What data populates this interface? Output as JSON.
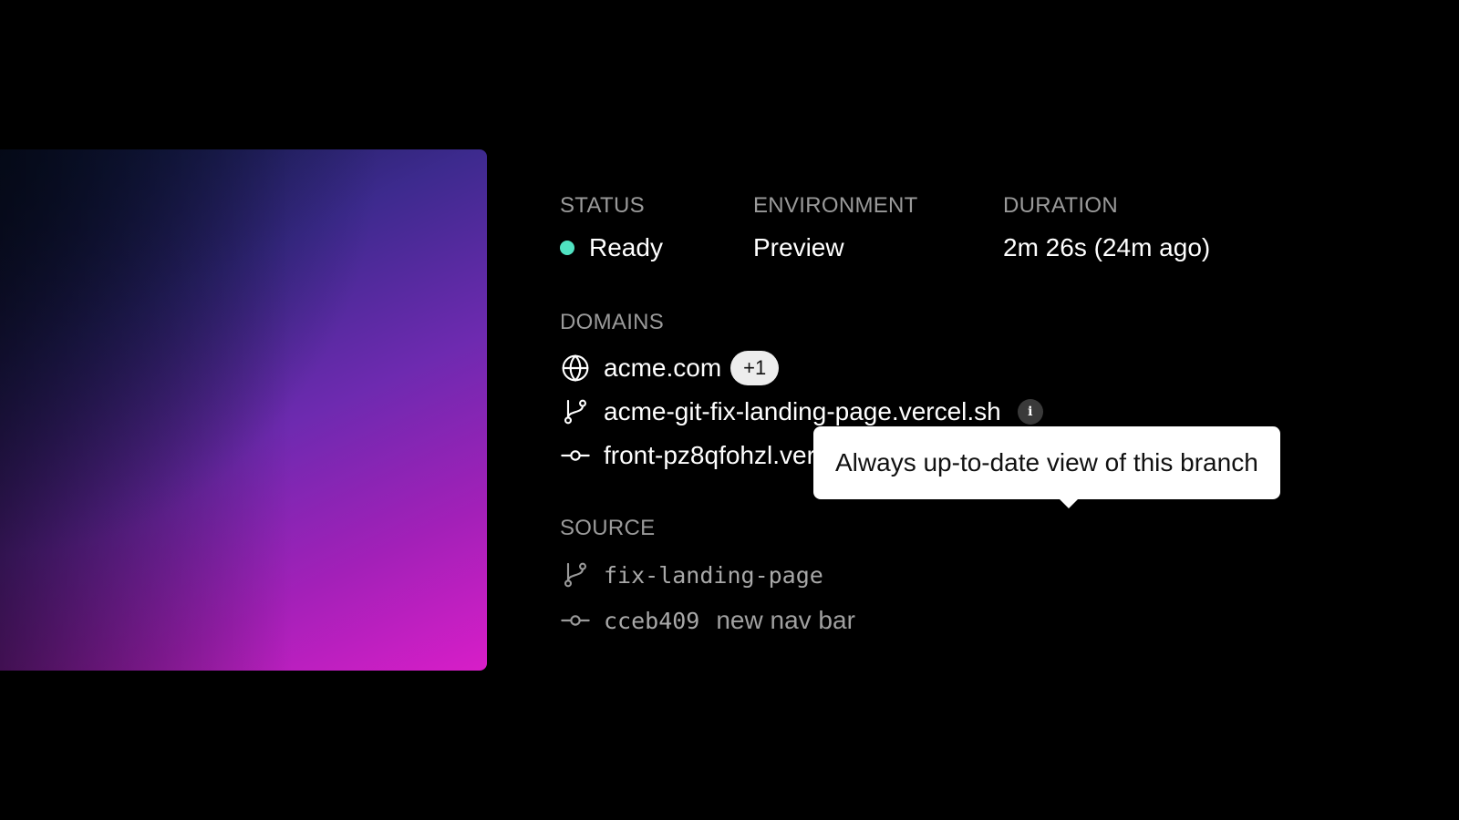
{
  "status": {
    "label": "STATUS",
    "value": "Ready",
    "color": "#50e3c2"
  },
  "environment": {
    "label": "ENVIRONMENT",
    "value": "Preview"
  },
  "duration": {
    "label": "DURATION",
    "value": "2m 26s (24m ago)"
  },
  "domains": {
    "label": "DOMAINS",
    "items": [
      {
        "icon": "globe-icon",
        "text": "acme.com",
        "badge": "+1"
      },
      {
        "icon": "git-branch-icon",
        "text": "acme-git-fix-landing-page.vercel.sh",
        "info": "i"
      },
      {
        "icon": "git-commit-icon",
        "text": "front-pz8qfohzl.vercel.sh",
        "info": "i"
      }
    ],
    "tooltip": "Always up-to-date view of this branch"
  },
  "source": {
    "label": "SOURCE",
    "branch": {
      "icon": "git-branch-icon",
      "text": "fix-landing-page"
    },
    "commit": {
      "icon": "git-commit-icon",
      "hash": "cceb409",
      "message": "new nav bar"
    }
  }
}
